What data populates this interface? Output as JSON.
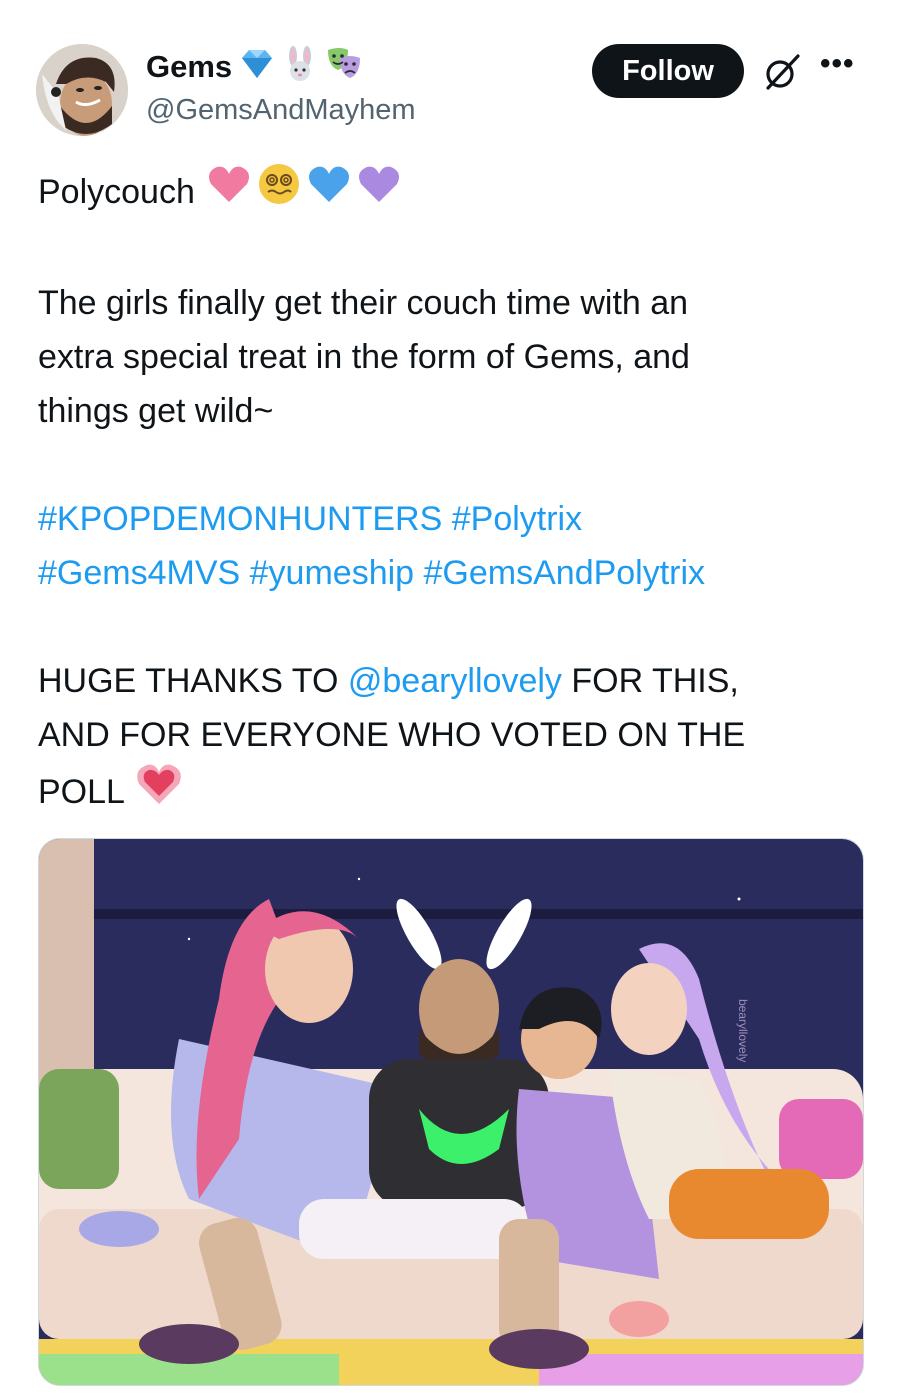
{
  "author": {
    "display_name": "Gems",
    "badges": [
      "diamond-icon",
      "bunny-icon",
      "theater-masks-icon"
    ],
    "handle": "@GemsAndMayhem"
  },
  "actions": {
    "follow_label": "Follow",
    "more_label": "•••"
  },
  "tweet": {
    "title": "Polycouch",
    "title_emojis": [
      "pink-heart-icon",
      "dizzy-face-icon",
      "blue-heart-icon",
      "purple-heart-icon"
    ],
    "body_line1": "The girls finally get their couch time with an",
    "body_line2": "extra special treat in the form of Gems, and",
    "body_line3": "things get wild~",
    "hashtags_line1": [
      "#KPOPDEMONHUNTERS",
      "#Polytrix"
    ],
    "hashtags_line2": [
      "#Gems4MVS",
      "#yumeship",
      "#GemsAndPolytrix"
    ],
    "thanks_prefix": "HUGE THANKS TO ",
    "thanks_mention": "@bearyllovely",
    "thanks_suffix": " FOR THIS,",
    "thanks_line2": "AND FOR EVERYONE WHO VOTED ON THE",
    "thanks_line3": "POLL",
    "thanks_emoji": "growing-heart-icon"
  },
  "media": {
    "signature": "bearyllovely"
  },
  "colors": {
    "link": "#1d9bf0",
    "text": "#0f1419",
    "secondary": "#536471",
    "follow_bg": "#0f1419"
  }
}
